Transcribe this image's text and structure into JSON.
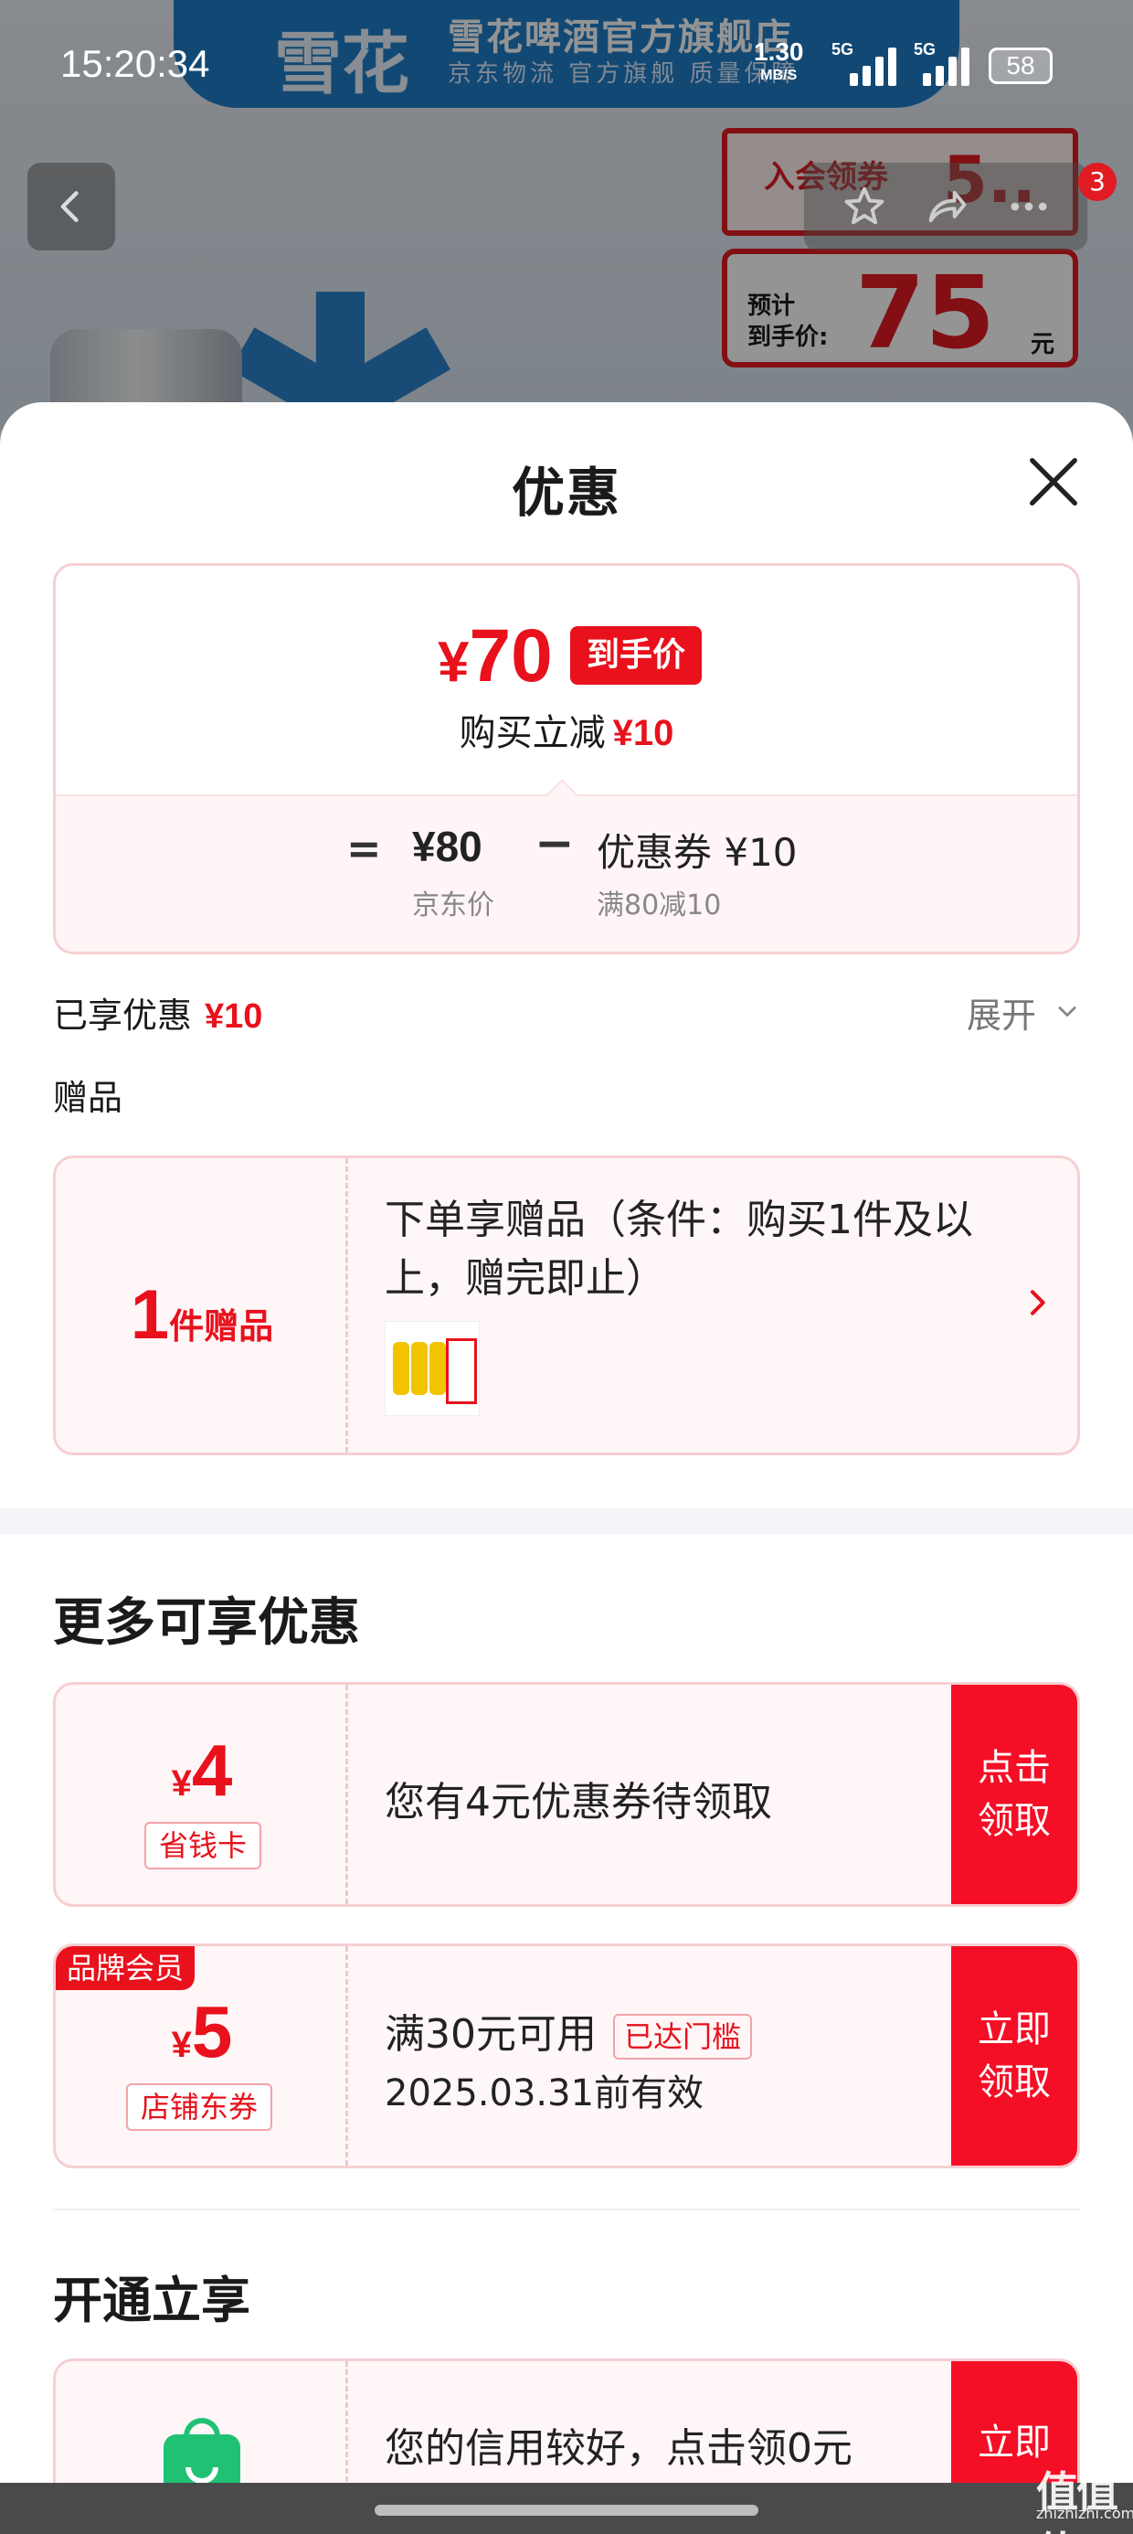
{
  "status_bar": {
    "time": "15:20:34",
    "net_speed": "1.30",
    "net_unit": "MB/S",
    "signal1": "5G",
    "signal2": "5G",
    "battery": "58"
  },
  "background": {
    "brand_logo": "雪花",
    "shop_name": "雪花啤酒官方旗舰店",
    "shop_sub": "京东物流  官方旗舰  质量保障",
    "vip_coupon": "入会领券",
    "vip_amount": "5..",
    "est_label": "预计\n到手价:",
    "est_price": "75",
    "est_unit": "元",
    "cart_badge": "3"
  },
  "sheet": {
    "title": "优惠",
    "price_card": {
      "currency": "¥",
      "final_price": "70",
      "final_tag": "到手价",
      "reduce_label": "购买立减",
      "reduce_value": "¥10",
      "equals": "=",
      "jd_price": "¥80",
      "jd_price_label": "京东价",
      "minus": "−",
      "coupon_value": "优惠券 ¥10",
      "coupon_rule": "满80减10"
    },
    "enjoyed_label": "已享优惠",
    "enjoyed_value": "¥10",
    "expand_label": "展开",
    "gift_section_label": "赠品",
    "gift": {
      "count": "1",
      "count_unit": "件赠品",
      "desc": "下单享赠品（条件：购买1件及以上，赠完即止）"
    },
    "more_title": "更多可享优惠",
    "coupons": [
      {
        "currency": "¥",
        "amount": "4",
        "tag": "省钱卡",
        "text": "您有4元优惠券待领取",
        "button": "点击领取"
      },
      {
        "corner": "品牌会员",
        "currency": "¥",
        "amount": "5",
        "tag": "店铺东券",
        "text": "满30元可用",
        "status": "已达门槛",
        "validity": "2025.03.31前有效",
        "button": "立即领取"
      }
    ],
    "open_title": "开通立享",
    "open_card": {
      "text": "您的信用较好，点击领0元",
      "button": "立即"
    }
  },
  "watermark": {
    "main": "值值值",
    "sub": "zhizhizhi.com"
  },
  "colors": {
    "accent": "#e8111c",
    "button": "#f40f26",
    "card_border": "#f6cfd2",
    "card_bg": "#fff6f7"
  }
}
